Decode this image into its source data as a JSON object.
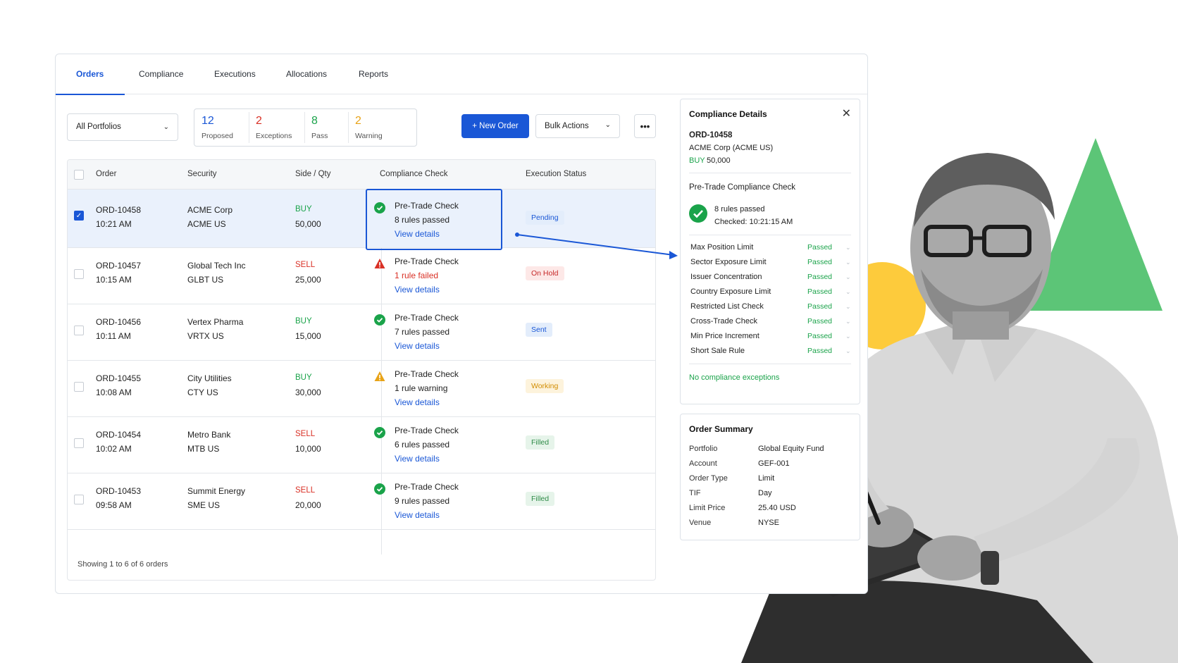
{
  "tabs": [
    {
      "label": "Orders",
      "active": true
    },
    {
      "label": "Compliance",
      "active": false
    },
    {
      "label": "Executions",
      "active": false
    },
    {
      "label": "Allocations",
      "active": false
    },
    {
      "label": "Reports",
      "active": false
    }
  ],
  "toolbar": {
    "portfolio_select": "All Portfolios",
    "stats": [
      {
        "value": "12",
        "label": "Proposed",
        "color": "#1a57d6"
      },
      {
        "value": "2",
        "label": "Exceptions",
        "color": "#d93025"
      },
      {
        "value": "8",
        "label": "Pass",
        "color": "#1aa34a"
      },
      {
        "value": "2",
        "label": "Warning",
        "color": "#e8a317"
      }
    ],
    "new_order_label": "+  New Order",
    "bulk_actions_label": "Bulk Actions",
    "more_label": "•••"
  },
  "table": {
    "headers": {
      "order": "Order",
      "security": "Security",
      "side_qty": "Side / Qty",
      "compliance": "Compliance Check",
      "execution": "Execution Status"
    },
    "rows": [
      {
        "id": "ORD-10458",
        "time": "10:21 AM",
        "security": "ACME Corp",
        "ticker": "ACME US",
        "side": "BUY",
        "qty": "50,000",
        "check_title": "Pre-Trade Check",
        "check_result": "8 rules passed",
        "check_status": "pass",
        "link": "View details",
        "exec": "Pending",
        "exec_kind": "pending",
        "selected": true
      },
      {
        "id": "ORD-10457",
        "time": "10:15 AM",
        "security": "Global Tech Inc",
        "ticker": "GLBT US",
        "side": "SELL",
        "qty": "25,000",
        "check_title": "Pre-Trade Check",
        "check_result": "1 rule failed",
        "check_status": "fail",
        "link": "View details",
        "exec": "On Hold",
        "exec_kind": "hold",
        "selected": false
      },
      {
        "id": "ORD-10456",
        "time": "10:11 AM",
        "security": "Vertex Pharma",
        "ticker": "VRTX US",
        "side": "BUY",
        "qty": "15,000",
        "check_title": "Pre-Trade Check",
        "check_result": "7 rules passed",
        "check_status": "pass",
        "link": "View details",
        "exec": "Sent",
        "exec_kind": "sent",
        "selected": false
      },
      {
        "id": "ORD-10455",
        "time": "10:08 AM",
        "security": "City Utilities",
        "ticker": "CTY US",
        "side": "BUY",
        "qty": "30,000",
        "check_title": "Pre-Trade Check",
        "check_result": "1 rule warning",
        "check_status": "warning",
        "link": "View details",
        "exec": "Working",
        "exec_kind": "working",
        "selected": false
      },
      {
        "id": "ORD-10454",
        "time": "10:02 AM",
        "security": "Metro Bank",
        "ticker": "MTB US",
        "side": "SELL",
        "qty": "10,000",
        "check_title": "Pre-Trade Check",
        "check_result": "6 rules passed",
        "check_status": "pass",
        "link": "View details",
        "exec": "Filled",
        "exec_kind": "filled",
        "selected": false
      },
      {
        "id": "ORD-10453",
        "time": "09:58 AM",
        "security": "Summit Energy",
        "ticker": "SME US",
        "side": "SELL",
        "qty": "20,000",
        "check_title": "Pre-Trade Check",
        "check_result": "9 rules passed",
        "check_status": "pass",
        "link": "View details",
        "exec": "Filled",
        "exec_kind": "filled",
        "selected": false
      }
    ],
    "footer": "Showing 1 to 6 of 6 orders"
  },
  "compliance_panel": {
    "title": "Compliance Details",
    "close": "✕",
    "order_id": "ORD-10458",
    "security": "ACME Corp (ACME US)",
    "side": "BUY",
    "qty": "50,000",
    "section_title": "Pre-Trade Compliance Check",
    "result": "8 rules passed",
    "checked": "Checked: 10:21:15 AM",
    "rules": [
      {
        "name": "Max Position Limit",
        "status": "Passed"
      },
      {
        "name": "Sector Exposure Limit",
        "status": "Passed"
      },
      {
        "name": "Issuer Concentration",
        "status": "Passed"
      },
      {
        "name": "Country Exposure Limit",
        "status": "Passed"
      },
      {
        "name": "Restricted List Check",
        "status": "Passed"
      },
      {
        "name": "Cross-Trade Check",
        "status": "Passed"
      },
      {
        "name": "Min Price Increment",
        "status": "Passed"
      },
      {
        "name": "Short Sale Rule",
        "status": "Passed"
      }
    ],
    "footer": "No compliance exceptions"
  },
  "order_summary": {
    "title": "Order Summary",
    "fields": [
      {
        "label": "Portfolio",
        "value": "Global Equity Fund"
      },
      {
        "label": "Account",
        "value": "GEF-001"
      },
      {
        "label": "Order Type",
        "value": "Limit"
      },
      {
        "label": "TIF",
        "value": "Day"
      },
      {
        "label": "Limit Price",
        "value": "25.40 USD"
      },
      {
        "label": "Venue",
        "value": "NYSE"
      }
    ]
  },
  "colors": {
    "accent": "#1a57d6",
    "pass": "#1aa34a",
    "fail": "#d93025",
    "warning": "#e8a317",
    "deco_green": "#5cc577",
    "deco_yellow": "#fdcb3c"
  }
}
